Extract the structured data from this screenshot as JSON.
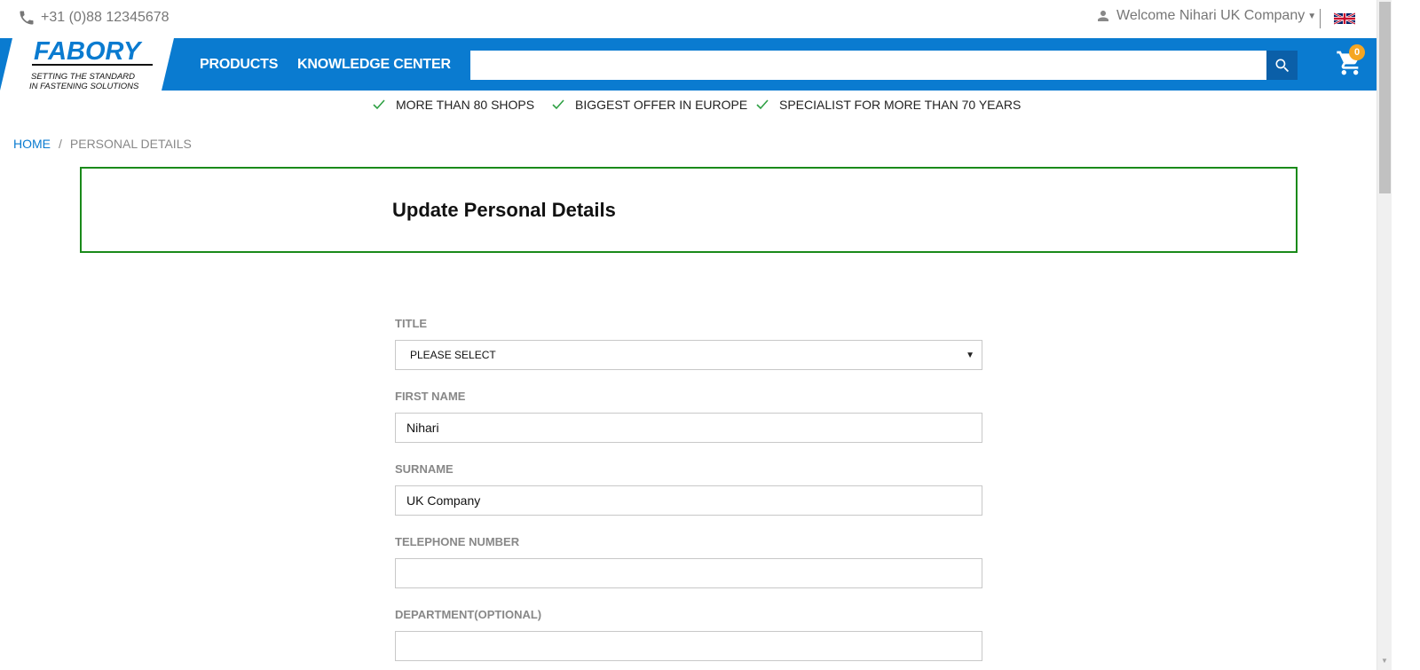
{
  "topbar": {
    "phone": "+31 (0)88 12345678",
    "welcome": "Welcome Nihari UK Company",
    "language_flag": "uk-flag-icon"
  },
  "nav": {
    "logo_name": "FABORY",
    "logo_tagline_1": "SETTING THE STANDARD",
    "logo_tagline_2": "IN FASTENING SOLUTIONS",
    "links": [
      "PRODUCTS",
      "KNOWLEDGE CENTER"
    ],
    "search_placeholder": "",
    "cart_count": "0",
    "colors": {
      "primary": "#0a7bd0",
      "search_button": "#0b5fa8",
      "badge": "#f5a623"
    }
  },
  "usps": [
    "MORE THAN 80 SHOPS",
    "BIGGEST OFFER IN EUROPE",
    "SPECIALIST FOR MORE THAN 70 YEARS"
  ],
  "breadcrumb": {
    "home": "HOME",
    "separator": "/",
    "current": "PERSONAL DETAILS"
  },
  "page": {
    "title": "Update Personal Details",
    "border_color": "#1a8a1a"
  },
  "form": {
    "title": {
      "label": "TITLE",
      "value": "PLEASE SELECT"
    },
    "first_name": {
      "label": "FIRST NAME",
      "value": "Nihari"
    },
    "surname": {
      "label": "SURNAME",
      "value": "UK Company"
    },
    "telephone": {
      "label": "TELEPHONE NUMBER",
      "value": ""
    },
    "department": {
      "label": "DEPARTMENT(OPTIONAL)",
      "value": ""
    }
  }
}
